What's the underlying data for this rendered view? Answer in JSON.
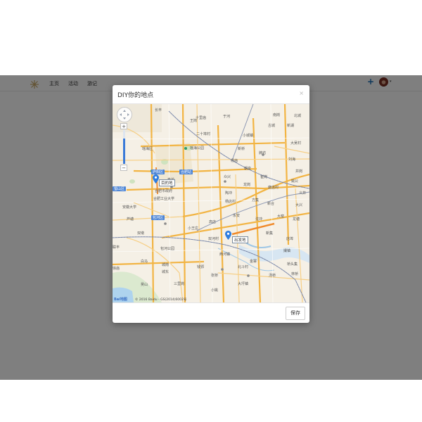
{
  "nav": {
    "logo_icon": "flower-logo-icon",
    "links": [
      "主页",
      "活动",
      "游记"
    ],
    "plus": "+",
    "avatar_caret": "▾"
  },
  "modal": {
    "title": "DIY你的地点",
    "close": "×",
    "save": "保存"
  },
  "map": {
    "zoom_in": "+",
    "zoom_out": "−",
    "zoom_level": 0.25,
    "start_pin": "目的地",
    "end_pin": "出发地",
    "copyright": "© 2016 Baidu - GS(2014)6002号",
    "baidu_logo": "Bai地图",
    "labels": [
      "十里庙",
      "于河",
      "北城",
      "古城",
      "大吴村",
      "二十埠村",
      "小城镇",
      "新湖",
      "瑶海区",
      "瑶海公园",
      "合肥站",
      "新桥",
      "朝泉",
      "杏花",
      "蜀山区",
      "庐阳区",
      "合肥工业大学",
      "合肥市政府",
      "杨店村",
      "龙岗",
      "包河区",
      "安徽大学",
      "小王庄",
      "方集",
      "西河镇",
      "北斗村",
      "大圩镇",
      "三里岗",
      "小姚",
      "吴山",
      "撮镇",
      "桥头集",
      "新集",
      "店埠",
      "龙塘",
      "长丰",
      "双河村",
      "高店",
      "刘海",
      "包河公园",
      "永安",
      "姚公",
      "新合",
      "大窑",
      "磨店村",
      "杨庙",
      "崔岗",
      "义井",
      "众兴",
      "南岗",
      "王岗",
      "牌坊",
      "陶冲",
      "白马",
      "城东",
      "城南",
      "林桥",
      "张桥",
      "双墩",
      "芦塘",
      "钱郢",
      "联丰",
      "大兴",
      "沈冲",
      "徐庙",
      "金寨",
      "汤桥",
      "井岗"
    ]
  }
}
